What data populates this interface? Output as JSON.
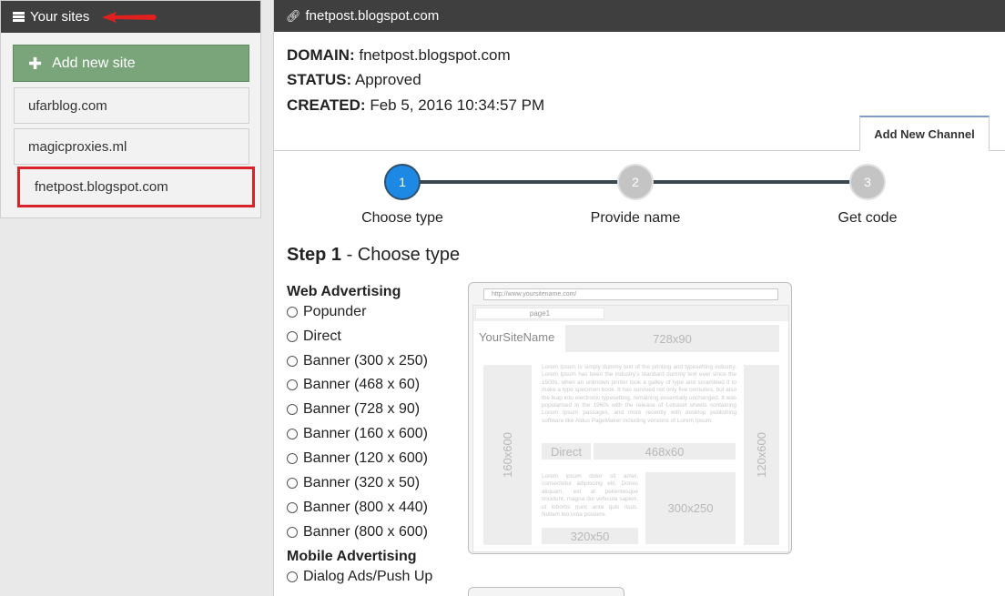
{
  "sidebar": {
    "title": "Your sites",
    "add_button_label": "Add new site",
    "sites": [
      "ufarblog.com",
      "magicproxies.ml",
      "fnetpost.blogspot.com"
    ]
  },
  "main": {
    "header_title": "fnetpost.blogspot.com",
    "domain_label": "DOMAIN:",
    "domain_value": "fnetpost.blogspot.com",
    "status_label": "STATUS:",
    "status_value": "Approved",
    "created_label": "CREATED:",
    "created_value": "Feb 5, 2016 10:34:57 PM",
    "tab_label": "Add New Channel"
  },
  "stepper": {
    "steps": [
      {
        "number": "1",
        "label": "Choose type"
      },
      {
        "number": "2",
        "label": "Provide name"
      },
      {
        "number": "3",
        "label": "Get code"
      }
    ]
  },
  "step_title": {
    "prefix": "Step 1",
    "suffix": "- Choose type"
  },
  "ad_types": {
    "web_heading": "Web Advertising",
    "web": [
      "Popunder",
      "Direct",
      "Banner (300 x 250)",
      "Banner (468 x 60)",
      "Banner (728 x 90)",
      "Banner (160 x 600)",
      "Banner (120 x 600)",
      "Banner (320 x 50)",
      "Banner (800 x 440)",
      "Banner (800 x 600)"
    ],
    "mobile_heading": "Mobile Advertising",
    "mobile": [
      "Dialog Ads/Push Up"
    ]
  },
  "preview": {
    "url": "http://www.yoursitename.com/",
    "tab": "page1",
    "site_name": "YourSiteName",
    "box_728": "728x90",
    "box_160": "160x600",
    "box_120": "120x600",
    "box_direct": "Direct",
    "box_468": "468x60",
    "box_300": "300x250",
    "box_320": "320x50",
    "lorem_1": "Lorem Ipsum is simply dummy text of the printing and typesetting industry. Lorem Ipsum has been the industry's standard dummy text ever since the 1500s, when an unknown printer took a galley of type and scrambled it to make a type specimen book. It has survived not only five centuries, but also the leap into electronic typesetting, remaining essentially unchanged. It was popularised in the 1960s with the release of Letraset sheets containing Lorem Ipsum passages, and more recently with desktop publishing software like Aldus PageMaker including versions of Lorem Ipsum.",
    "lorem_2": "Lorem ipsum dolor sit amet, consectetur adipiscing elit. Donec aliquam, est at pellentesque tincidunt, magna dui vehicula sapien, ut lobortis nunc ante quis risus. Nullam leo urna posuere."
  },
  "colors": {
    "header_bg": "#3f3f3f",
    "add_button_bg": "#7aa57b",
    "selected_border": "#d9222a",
    "active_step": "#1e88e5",
    "inactive_step": "#c4c4c4"
  }
}
